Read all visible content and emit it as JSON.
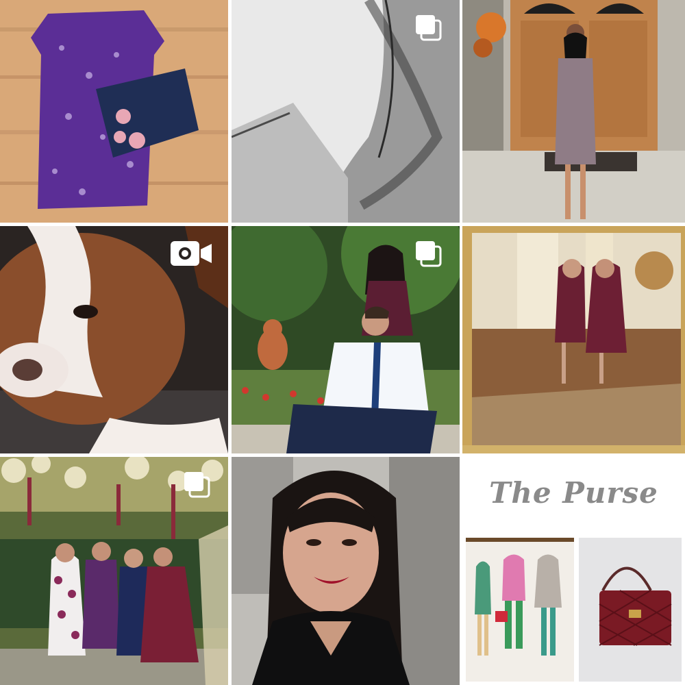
{
  "grid": {
    "posts": [
      {
        "id": "post-1",
        "subject": "purple-dress-and-jeans",
        "badge": null
      },
      {
        "id": "post-2",
        "subject": "bleached-denim-closeup",
        "badge": "multiple-images-icon"
      },
      {
        "id": "post-3",
        "subject": "woman-sequin-dress-at-door",
        "badge": null
      },
      {
        "id": "post-4",
        "subject": "boston-terrier-dog",
        "badge": "video-camera-icon"
      },
      {
        "id": "post-5",
        "subject": "couple-in-garden",
        "badge": "multiple-images-icon"
      },
      {
        "id": "post-6",
        "subject": "mirror-selfie-two-women",
        "badge": null
      },
      {
        "id": "post-7",
        "subject": "four-women-under-floral-arch",
        "badge": "multiple-images-icon"
      },
      {
        "id": "post-8",
        "subject": "car-selfie",
        "badge": null
      },
      {
        "id": "post-9",
        "subject": "the-purse-collage",
        "badge": null,
        "title": "The Purse"
      }
    ]
  },
  "colors": {
    "background": "#ffffff",
    "badge": "#ffffff",
    "purse_title": "#8a8a8a"
  }
}
